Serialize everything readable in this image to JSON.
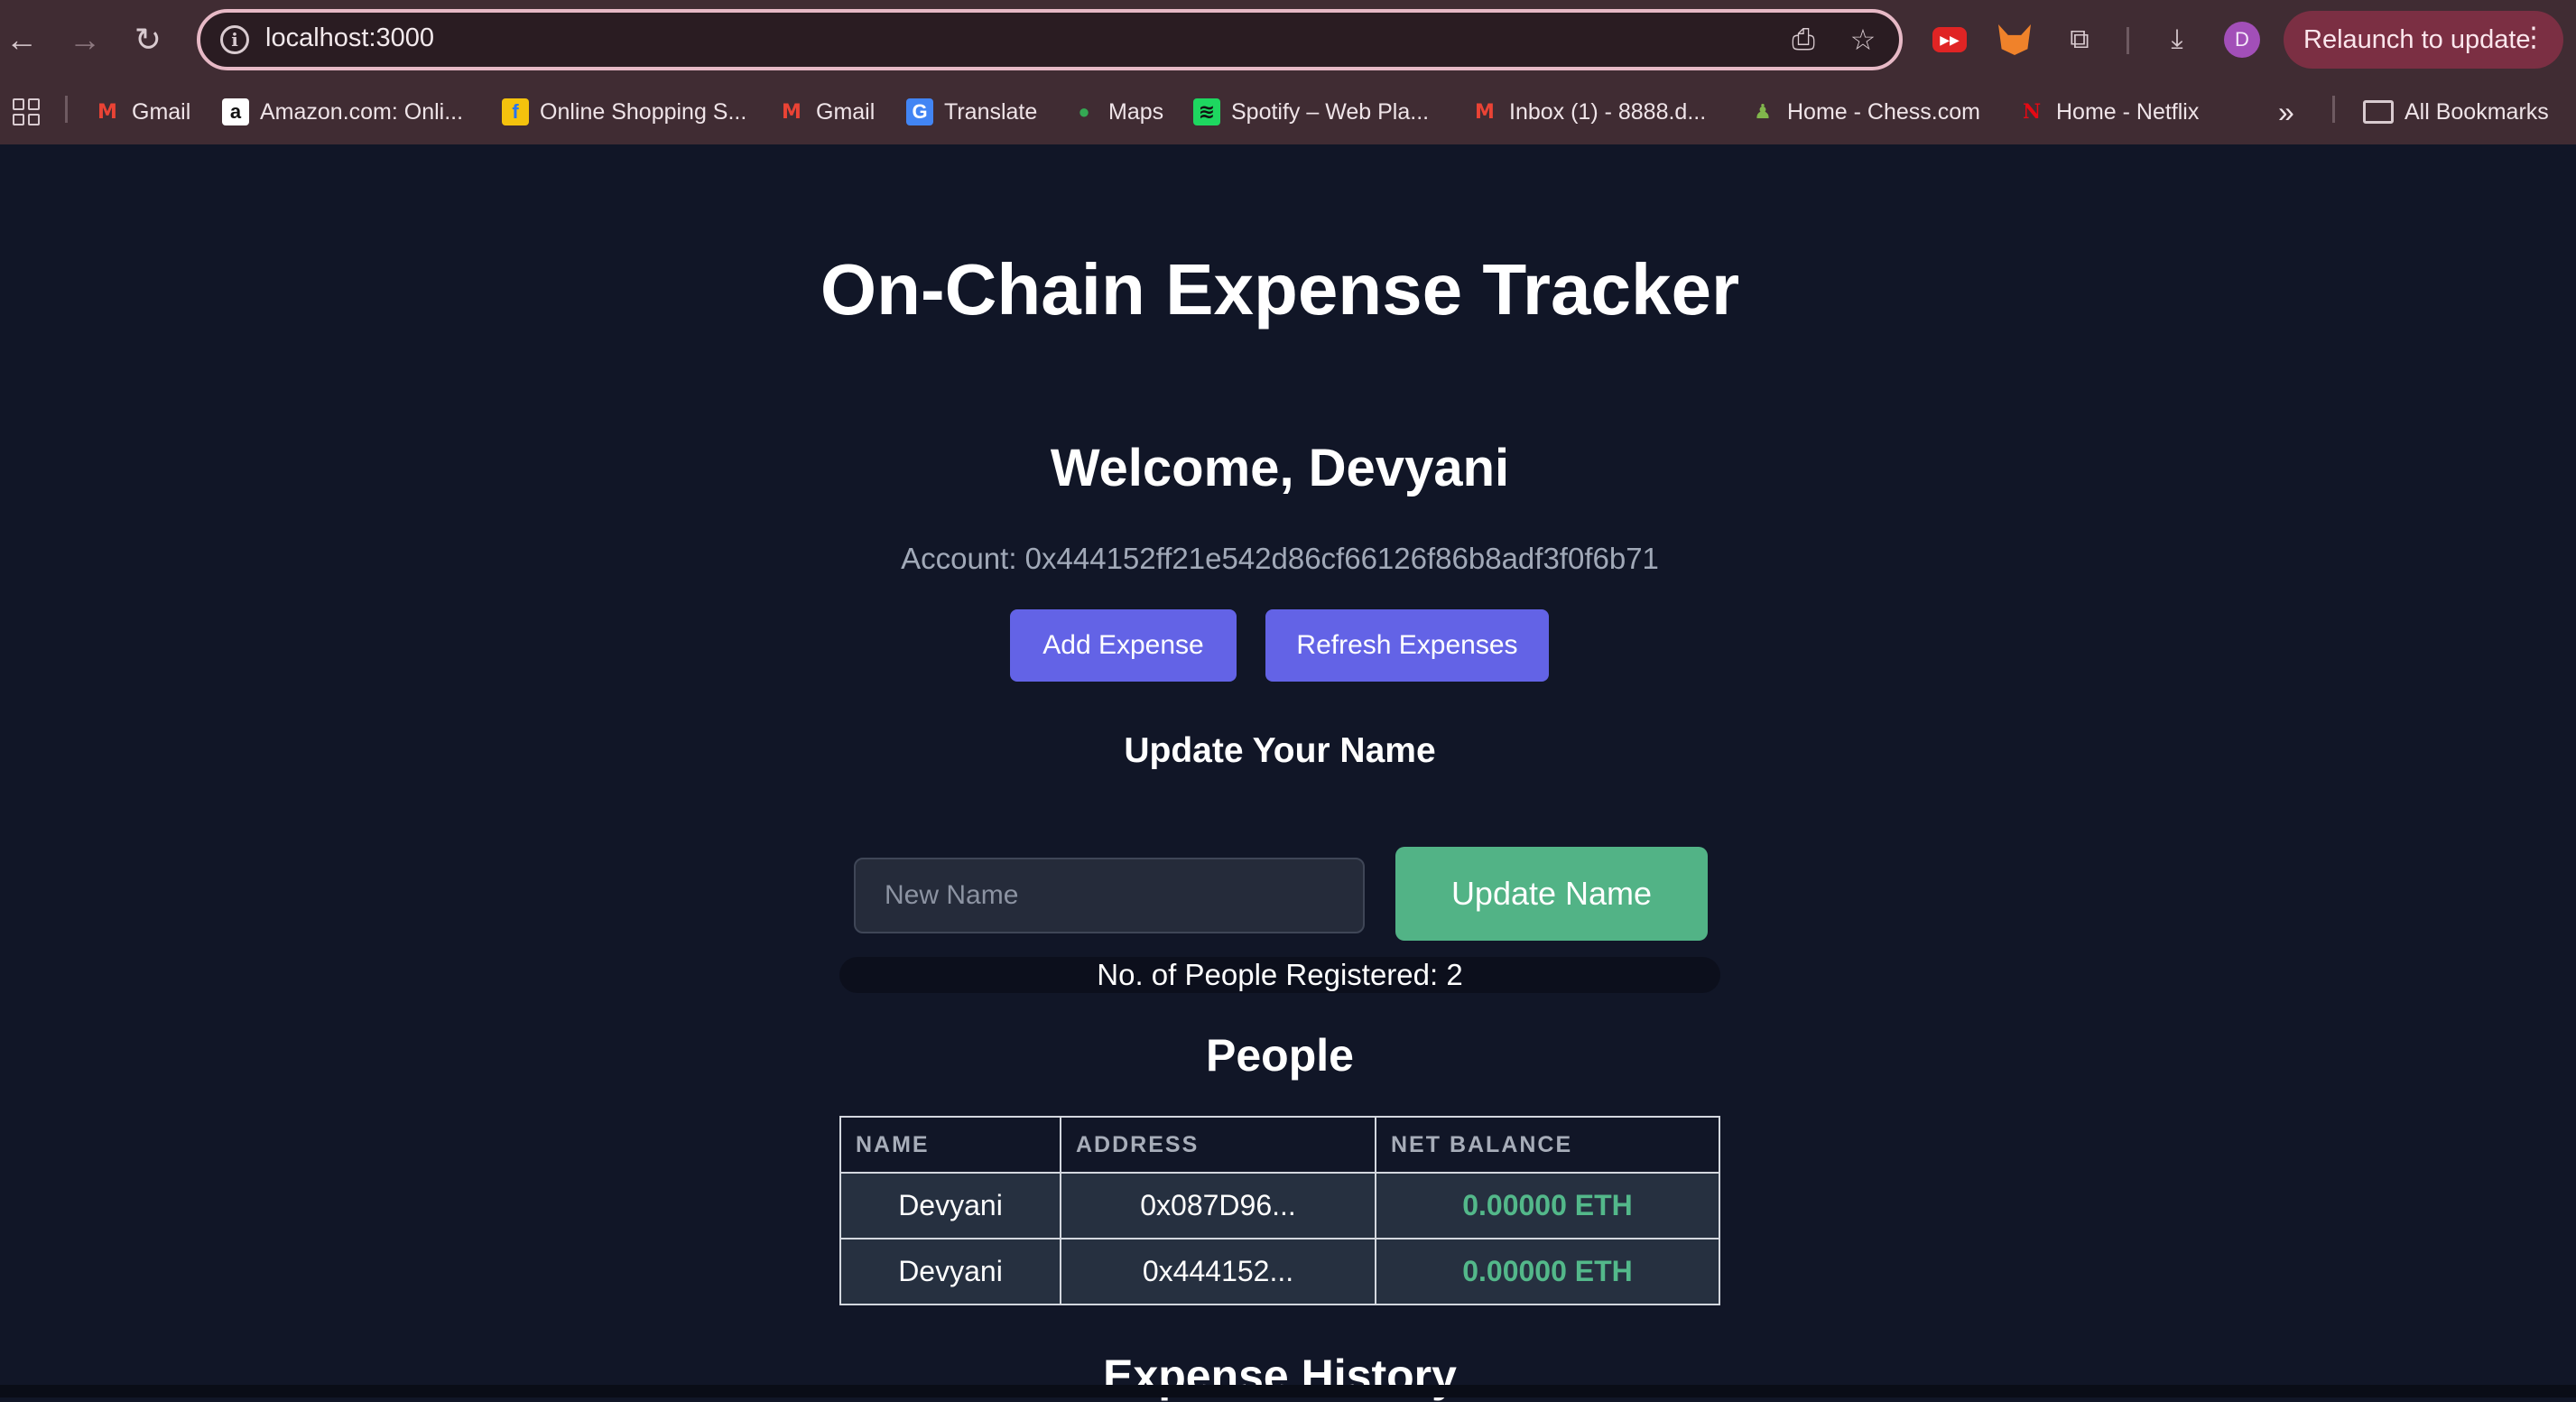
{
  "browser": {
    "url": "localhost:3000",
    "profile_initial": "D",
    "relaunch_label": "Relaunch to update",
    "bookmarks": [
      {
        "label": "Gmail",
        "icon": "gmail-icon"
      },
      {
        "label": "Amazon.com: Onli...",
        "icon": "amazon-icon"
      },
      {
        "label": "Online Shopping S...",
        "icon": "flipkart-icon"
      },
      {
        "label": "Gmail",
        "icon": "gmail-icon"
      },
      {
        "label": "Translate",
        "icon": "translate-icon"
      },
      {
        "label": "Maps",
        "icon": "maps-icon"
      },
      {
        "label": "Spotify – Web Pla...",
        "icon": "spotify-icon"
      },
      {
        "label": "Inbox (1) - 8888.d...",
        "icon": "gmail-icon"
      },
      {
        "label": "Home - Chess.com",
        "icon": "chess-icon"
      },
      {
        "label": "Home - Netflix",
        "icon": "netflix-icon"
      }
    ],
    "more_bookmarks": "»",
    "all_bookmarks": "All Bookmarks"
  },
  "app": {
    "title": "On-Chain Expense Tracker",
    "welcome": "Welcome, Devyani",
    "account": "Account: 0x444152ff21e542d86cf66126f86b8adf3f0f6b71",
    "add_expense_label": "Add Expense",
    "refresh_expenses_label": "Refresh Expenses",
    "update_name_heading": "Update Your Name",
    "new_name_placeholder": "New Name",
    "update_name_label": "Update Name",
    "registered_count": "No. of People Registered: 2",
    "people_heading": "People",
    "people_columns": [
      "NAME",
      "ADDRESS",
      "NET BALANCE"
    ],
    "people_rows": [
      {
        "name": "Devyani",
        "address": "0x087D96...",
        "balance": "0.00000 ETH"
      },
      {
        "name": "Devyani",
        "address": "0x444152...",
        "balance": "0.00000 ETH"
      }
    ],
    "history_heading": "Expense History"
  },
  "colors": {
    "page_bg": "#111627",
    "primary": "#6363e6",
    "success": "#52b386",
    "chrome_bg": "#402c33"
  }
}
